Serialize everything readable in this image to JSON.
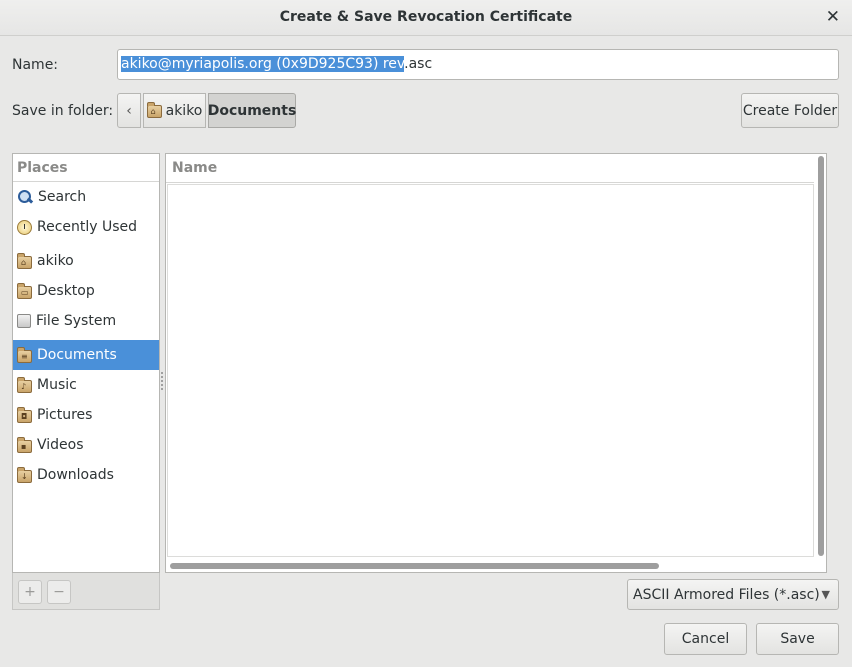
{
  "window": {
    "title": "Create & Save Revocation Certificate"
  },
  "name_field": {
    "label": "Name:",
    "selected_text": "akiko@myriapolis.org (0x9D925C93) rev",
    "rest_text": ".asc"
  },
  "save_in": {
    "label": "Save in folder:",
    "path": [
      "akiko",
      "Documents"
    ],
    "create_folder_label": "Create Folder"
  },
  "places": {
    "header": "Places",
    "items": [
      {
        "label": "Search",
        "icon": "search-icon"
      },
      {
        "label": "Recently Used",
        "icon": "recent-icon"
      },
      {
        "label": "akiko",
        "icon": "home-folder-icon"
      },
      {
        "label": "Desktop",
        "icon": "desktop-folder-icon"
      },
      {
        "label": "File System",
        "icon": "drive-icon"
      },
      {
        "label": "Documents",
        "icon": "documents-folder-icon",
        "selected": true
      },
      {
        "label": "Music",
        "icon": "music-folder-icon"
      },
      {
        "label": "Pictures",
        "icon": "pictures-folder-icon"
      },
      {
        "label": "Videos",
        "icon": "videos-folder-icon"
      },
      {
        "label": "Downloads",
        "icon": "downloads-folder-icon"
      }
    ],
    "add_label": "+",
    "remove_label": "−"
  },
  "file_list": {
    "column_name": "Name",
    "rows": []
  },
  "filter": {
    "selected": "ASCII Armored Files (*.asc)"
  },
  "actions": {
    "cancel_label": "Cancel",
    "save_label": "Save"
  },
  "colors": {
    "selection": "#4a90d9",
    "window_bg": "#e8e8e7"
  }
}
